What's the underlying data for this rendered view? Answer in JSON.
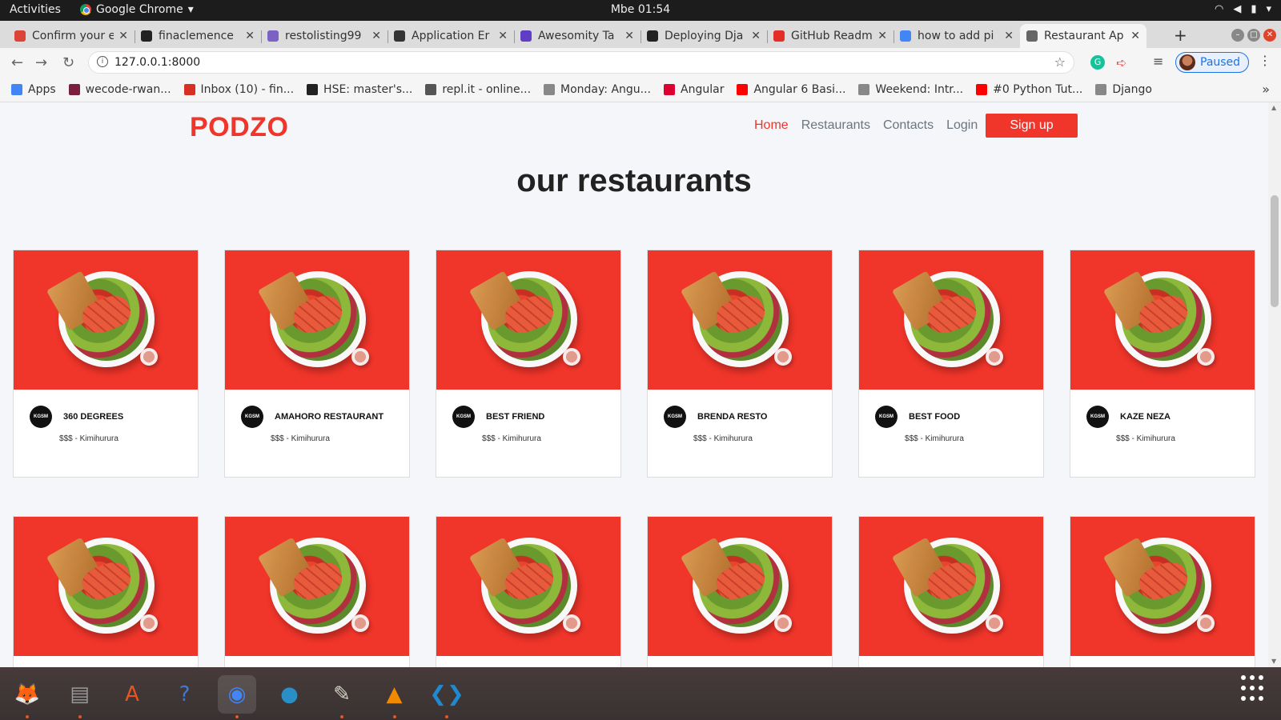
{
  "system_bar": {
    "activities": "Activities",
    "app_name": "Google Chrome",
    "app_menu_arrow": "▾",
    "clock": "Mbe 01:54"
  },
  "tabs": [
    {
      "title": "Confirm your e",
      "favicon_color": "#db4437"
    },
    {
      "title": "finaclemence",
      "favicon_color": "#222222"
    },
    {
      "title": "restolisting99",
      "favicon_color": "#7b61c4"
    },
    {
      "title": "Application Er",
      "favicon_color": "#333333"
    },
    {
      "title": "Awesomity Ta",
      "favicon_color": "#5f3dc4"
    },
    {
      "title": "Deploying Dja",
      "favicon_color": "#222222"
    },
    {
      "title": "GitHub Readm",
      "favicon_color": "#e52d27"
    },
    {
      "title": "how to add pi",
      "favicon_color": "#4285f4"
    },
    {
      "title": "Restaurant Ap",
      "favicon_color": "#666666",
      "active": true
    }
  ],
  "address_bar": {
    "url": "127.0.0.1:8000",
    "profile_label": "Paused",
    "extension_initial": "G"
  },
  "bookmarks": [
    {
      "label": "Apps",
      "icon": "apps-grid-icon",
      "color": "#4285f4"
    },
    {
      "label": "wecode-rwan...",
      "icon": "wecode-icon",
      "color": "#7a1f3d"
    },
    {
      "label": "Inbox (10) - fin...",
      "icon": "gmail-icon",
      "color": "#d93025"
    },
    {
      "label": "HSE: master's...",
      "icon": "hse-icon",
      "color": "#222222"
    },
    {
      "label": "repl.it - online...",
      "icon": "replit-icon",
      "color": "#555555"
    },
    {
      "label": "Monday: Angu...",
      "icon": "pin-icon",
      "color": "#888888"
    },
    {
      "label": "Angular",
      "icon": "angular-icon",
      "color": "#dd0031"
    },
    {
      "label": "Angular 6 Basi...",
      "icon": "youtube-icon",
      "color": "#ff0000"
    },
    {
      "label": "Weekend: Intr...",
      "icon": "pin-icon",
      "color": "#888888"
    },
    {
      "label": "#0 Python Tut...",
      "icon": "youtube-icon",
      "color": "#ff0000"
    },
    {
      "label": "Django",
      "icon": "pin-icon",
      "color": "#888888"
    }
  ],
  "site": {
    "logo": "PODZO",
    "nav": [
      {
        "label": "Home",
        "active": true
      },
      {
        "label": "Restaurants"
      },
      {
        "label": "Contacts"
      },
      {
        "label": "Login"
      }
    ],
    "signup": "Sign up",
    "title": "our restaurants",
    "accent": "#f0352a",
    "badge_text": "KGSM",
    "restaurants": [
      {
        "name": "360 DEGREES",
        "meta": "$$$ - Kimihurura"
      },
      {
        "name": "AMAHORO RESTAURANT",
        "meta": "$$$ - Kimihurura"
      },
      {
        "name": "BEST FRIEND",
        "meta": "$$$ - Kimihurura"
      },
      {
        "name": "BRENDA RESTO",
        "meta": "$$$ - Kimihurura"
      },
      {
        "name": "BEST FOOD",
        "meta": "$$$ - Kimihurura"
      },
      {
        "name": "KAZE NEZA",
        "meta": "$$$ - Kimihurura"
      },
      {
        "name": "",
        "meta": ""
      },
      {
        "name": "",
        "meta": ""
      },
      {
        "name": "",
        "meta": ""
      },
      {
        "name": "",
        "meta": ""
      },
      {
        "name": "",
        "meta": ""
      },
      {
        "name": "",
        "meta": ""
      }
    ]
  },
  "dock": [
    {
      "name": "firefox-icon",
      "active": false,
      "running": true
    },
    {
      "name": "files-icon",
      "active": false,
      "running": true
    },
    {
      "name": "software-center-icon",
      "active": false,
      "running": false
    },
    {
      "name": "help-icon",
      "active": false,
      "running": false
    },
    {
      "name": "chrome-icon",
      "active": true,
      "running": true
    },
    {
      "name": "blue-circle-app-icon",
      "active": false,
      "running": false
    },
    {
      "name": "text-editor-icon",
      "active": false,
      "running": true
    },
    {
      "name": "vlc-icon",
      "active": false,
      "running": true
    },
    {
      "name": "vscode-icon",
      "active": false,
      "running": true
    }
  ]
}
